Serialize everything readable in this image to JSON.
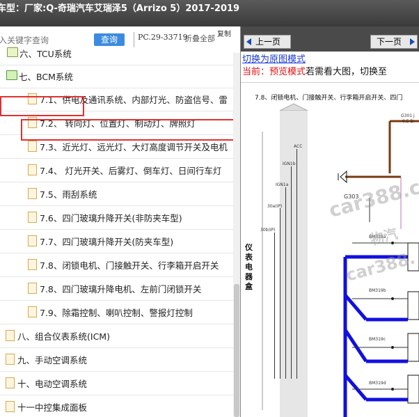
{
  "window": {
    "title": "车型：厂家:Q-奇瑞汽车艾瑞泽5（Arrizo 5）2017-2019"
  },
  "search": {
    "placeholder": "入关键字查询",
    "button": "查询",
    "code": "PC.29-33719",
    "collapse_all": "折叠全部",
    "copy": "复制"
  },
  "tree": {
    "items": [
      {
        "label": "六、TCU系统",
        "type": "folder"
      },
      {
        "label": "七、BCM系统",
        "type": "folder-open"
      },
      {
        "label": "7.1、供电及通讯系统、内部灯光、防盗信号、雷",
        "type": "doc"
      },
      {
        "label": "7.2、 转向灯、位置灯、制动灯、牌照灯",
        "type": "doc"
      },
      {
        "label": "7.3、近光灯、远光灯、大灯高度调节开关及电机",
        "type": "doc"
      },
      {
        "label": "7.4、 灯光开关、后雾灯、倒车灯、日间行车灯",
        "type": "doc"
      },
      {
        "label": "7.5、雨刮系统",
        "type": "doc"
      },
      {
        "label": "7.6、四门玻璃升降开关(非防夹车型)",
        "type": "doc"
      },
      {
        "label": "7.7、四门玻璃升降开关(防夹车型)",
        "type": "doc"
      },
      {
        "label": "7.8、闭锁电机、门接触开关、行李箱开启开关",
        "type": "doc"
      },
      {
        "label": "7.8、四门玻璃升降电机、左前门闭锁开关",
        "type": "doc"
      },
      {
        "label": "7.9、除霜控制、喇叭控制、警报灯控制",
        "type": "doc"
      },
      {
        "label": "八、组合仪表系统(ICM)",
        "type": "folder"
      },
      {
        "label": "九、手动空调系统",
        "type": "folder"
      },
      {
        "label": "十、电动空调系统",
        "type": "folder"
      },
      {
        "label": "十一中控集成面板",
        "type": "folder"
      }
    ]
  },
  "viewer": {
    "prev": "上一页",
    "next": "下一页",
    "switch_link": "切换为原图模式",
    "mode_prefix": "当前：预览模式",
    "mode_suffix": "若需看大图，切换至",
    "diagram_title": "7.8、闭锁电机、门接触开关、行李箱开启开关、四门",
    "panel_label": "仪表电器盒",
    "wire_labels": [
      "ACC",
      "IGN1b",
      "IGN1a",
      "30a(IP)",
      "30b(IP)",
      "G301 j",
      "0.5 Br",
      "G303",
      "BM319a",
      "BM319b",
      "BM319c",
      "BM319d"
    ],
    "watermarks": [
      "car388.c",
      "car388.",
      "物汽"
    ]
  },
  "colors": {
    "highlight": "#e03030",
    "wire_blue": "#1010e0",
    "wire_brown": "#7a3a10",
    "link": "#1a3ad0",
    "mode_red": "#e01010"
  }
}
